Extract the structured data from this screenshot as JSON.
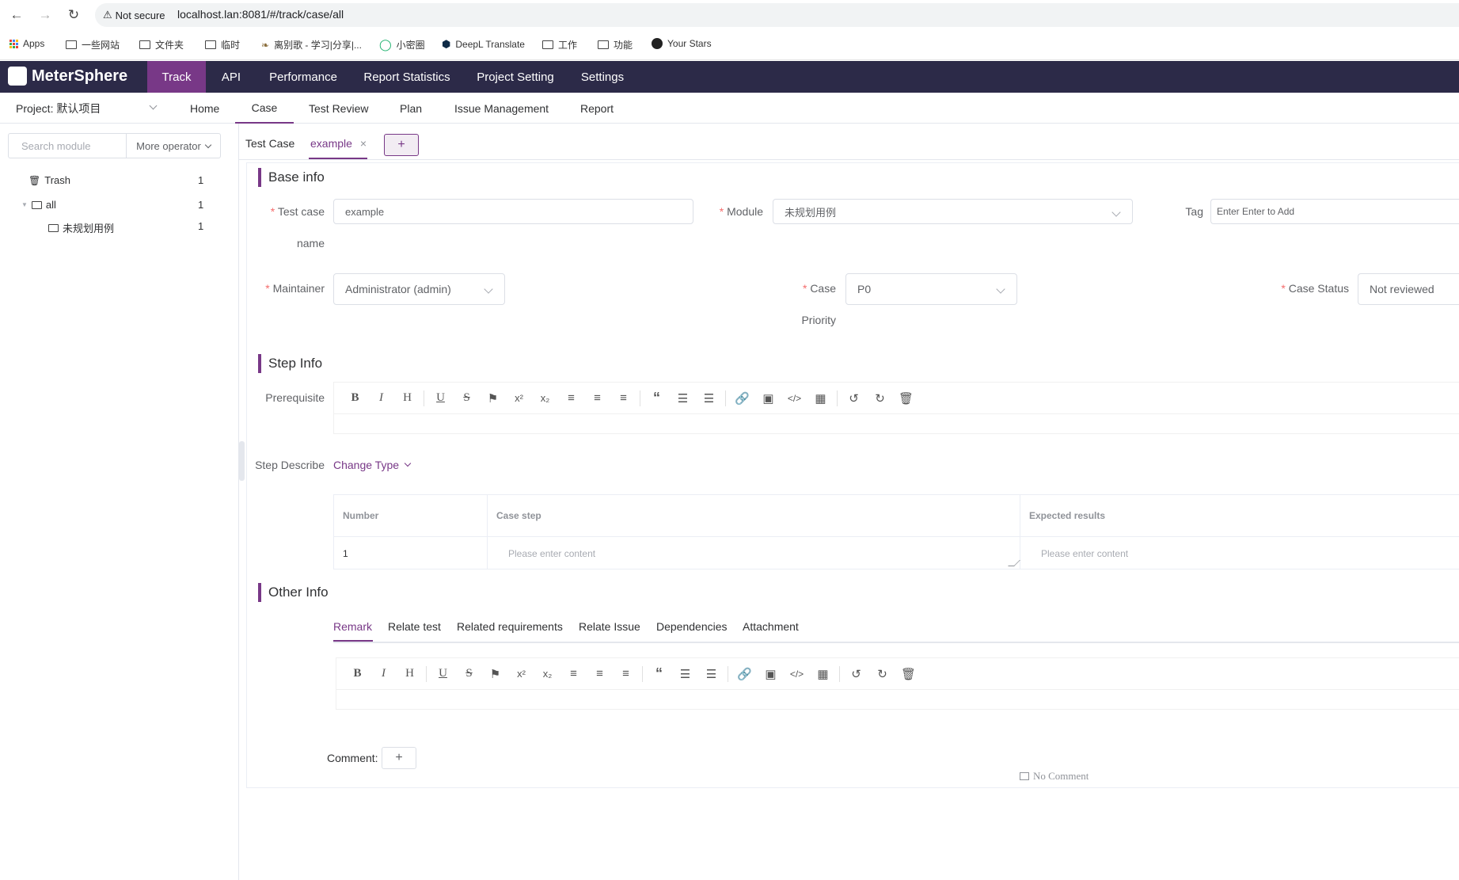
{
  "browser": {
    "security_label": "Not secure",
    "url": "localhost.lan:8081/#/track/case/all",
    "bookmarks": [
      "Apps",
      "一些网站",
      "文件夹",
      "临时",
      "离别歌 - 学习|分享|...",
      "小密圈",
      "DeepL Translate",
      "工作",
      "功能",
      "Your Stars"
    ]
  },
  "app": {
    "brand": "MeterSphere",
    "top_nav": [
      "Track",
      "API",
      "Performance",
      "Report Statistics",
      "Project Setting",
      "Settings"
    ],
    "active_top_nav": "Track",
    "project_label": "Project: 默认项目",
    "sub_nav": [
      "Home",
      "Case",
      "Test Review",
      "Plan",
      "Issue Management",
      "Report"
    ],
    "active_sub_nav": "Case",
    "accent_color": "#783887",
    "header_color": "#2c2a48"
  },
  "sidebar": {
    "search_placeholder": "Search module",
    "more_operator": "More operator",
    "tree": [
      {
        "label": "Trash",
        "count": "1"
      },
      {
        "label": "all",
        "count": "1"
      },
      {
        "label": "未规划用例",
        "count": "1"
      }
    ]
  },
  "tabs": {
    "items": [
      "Test Case",
      "example"
    ],
    "add_label": "+"
  },
  "base_info": {
    "title": "Base info",
    "test_case_label_1": "Test case",
    "test_case_label_2": "name",
    "test_case_value": "example",
    "module_label": "Module",
    "module_value": "未规划用例",
    "tag_label": "Tag",
    "tag_placeholder": "Enter Enter to Add",
    "maintainer_label": "Maintainer",
    "maintainer_value": "Administrator (admin)",
    "priority_label_1": "Case",
    "priority_label_2": "Priority",
    "priority_value": "P0",
    "status_label": "Case Status",
    "status_value": "Not reviewed"
  },
  "step_info": {
    "title": "Step Info",
    "prerequisite_label": "Prerequisite",
    "step_describe_label": "Step Describe",
    "change_type": "Change Type",
    "columns": [
      "Number",
      "Case step",
      "Expected results"
    ],
    "rows": [
      {
        "number": "1",
        "case_step_placeholder": "Please enter content",
        "expected_placeholder": "Please enter content"
      }
    ]
  },
  "other_info": {
    "title": "Other Info",
    "tabs": [
      "Remark",
      "Relate test",
      "Related requirements",
      "Relate Issue",
      "Dependencies",
      "Attachment"
    ],
    "active_tab": "Remark",
    "comment_label": "Comment:",
    "comment_add": "+",
    "no_comment": "No Comment"
  },
  "toolbar_icons": [
    "bold-icon",
    "italic-icon",
    "heading-icon",
    "underline-icon",
    "strikethrough-icon",
    "bookmark-icon",
    "superscript-icon",
    "subscript-icon",
    "align-left-icon",
    "align-center-icon",
    "align-right-icon",
    "quote-icon",
    "ordered-list-icon",
    "bullet-list-icon",
    "link-icon",
    "image-icon",
    "code-icon",
    "table-icon",
    "undo-icon",
    "redo-icon",
    "trash-icon"
  ]
}
